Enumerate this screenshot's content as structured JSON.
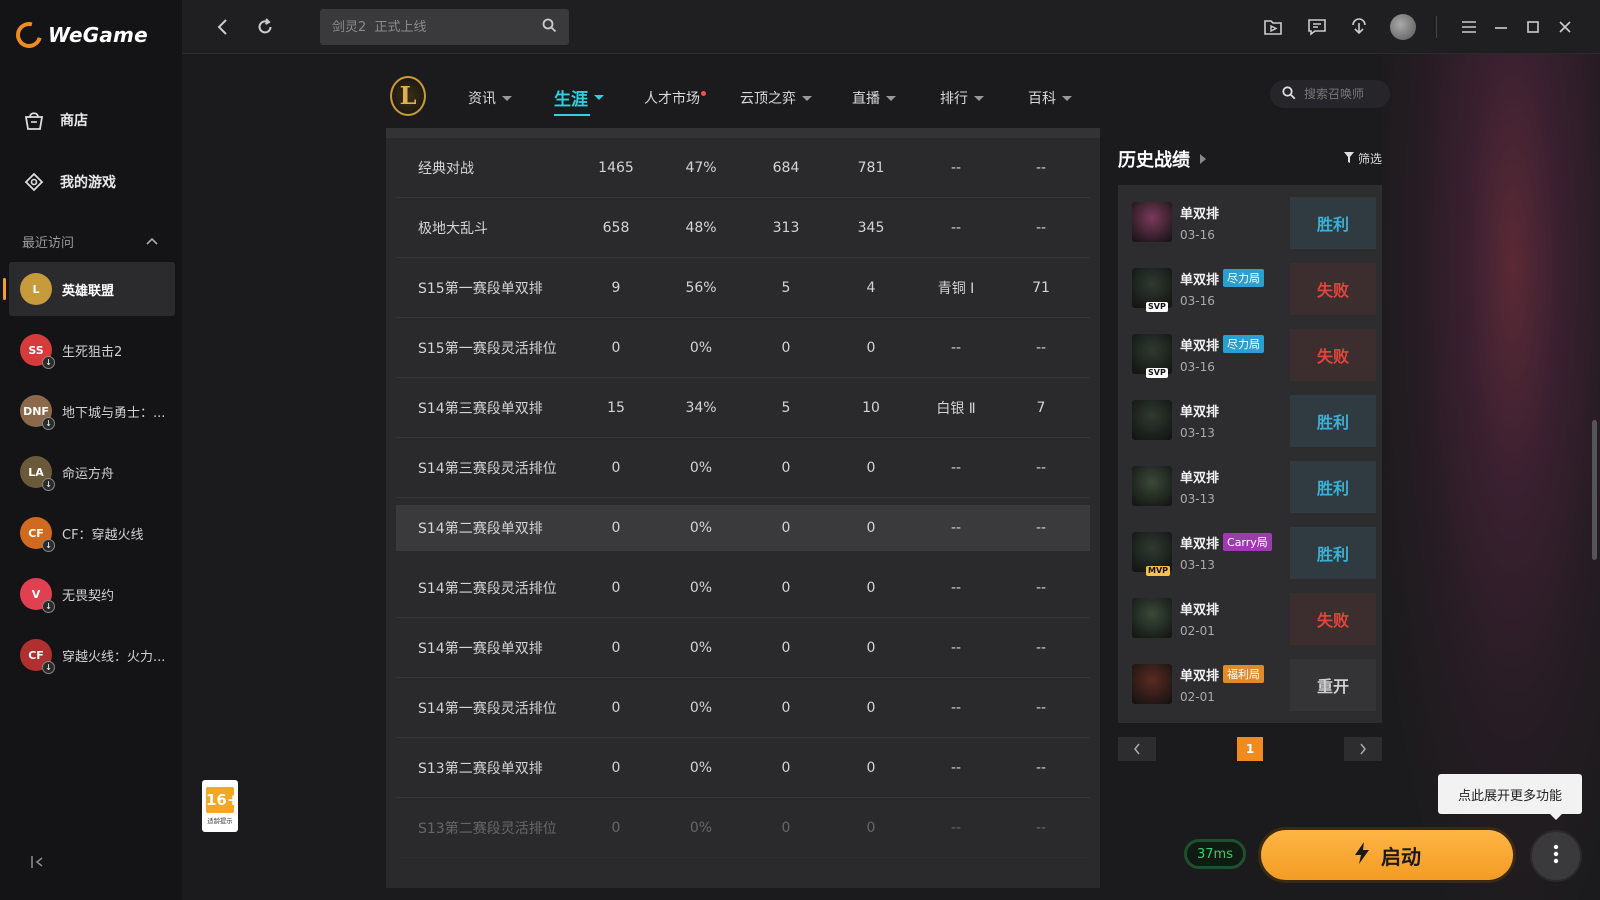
{
  "app": {
    "name": "WeGame"
  },
  "sidebar": {
    "main": [
      {
        "label": "商店",
        "icon": "store-bag-icon"
      },
      {
        "label": "我的游戏",
        "icon": "gamepad-icon"
      }
    ],
    "recent_header": "最近访问",
    "games": [
      {
        "label": "英雄联盟",
        "badge": "L",
        "color": "#c79a3c",
        "active": true
      },
      {
        "label": "生死狙击2",
        "badge": "SS",
        "color": "#d63a3a"
      },
      {
        "label": "地下城与勇士：...",
        "badge": "DNF",
        "color": "#8a6a4a"
      },
      {
        "label": "命运方舟",
        "badge": "LA",
        "color": "#6a5a3a"
      },
      {
        "label": "CF：穿越火线",
        "badge": "CF",
        "color": "#d06a20"
      },
      {
        "label": "无畏契约",
        "badge": "V",
        "color": "#e04050"
      },
      {
        "label": "穿越火线：火力...",
        "badge": "CF",
        "color": "#b03030"
      }
    ],
    "age_rating": {
      "num": "16+",
      "sub": "适龄提示"
    }
  },
  "topbar": {
    "search_placeholder": "剑灵2  正式上线"
  },
  "game_nav": {
    "logo": "L",
    "items": [
      {
        "label": "资讯",
        "caret": true
      },
      {
        "label": "生涯",
        "caret": true,
        "active": true
      },
      {
        "label": "人才市场",
        "caret": false,
        "dot": true
      },
      {
        "label": "云顶之弈",
        "caret": true
      },
      {
        "label": "直播",
        "caret": true
      },
      {
        "label": "排行",
        "caret": true
      },
      {
        "label": "百科",
        "caret": true
      }
    ],
    "summoner_placeholder": "搜索召唤师"
  },
  "stats": {
    "rows": [
      [
        "经典对战",
        "1465",
        "47%",
        "684",
        "781",
        "--",
        "--"
      ],
      [
        "极地大乱斗",
        "658",
        "48%",
        "313",
        "345",
        "--",
        "--"
      ],
      [
        "S15第一赛段单双排",
        "9",
        "56%",
        "5",
        "4",
        "青铜 Ⅰ",
        "71"
      ],
      [
        "S15第一赛段灵活排位",
        "0",
        "0%",
        "0",
        "0",
        "--",
        "--"
      ],
      [
        "S14第三赛段单双排",
        "15",
        "34%",
        "5",
        "10",
        "白银 Ⅱ",
        "7"
      ],
      [
        "S14第三赛段灵活排位",
        "0",
        "0%",
        "0",
        "0",
        "--",
        "--"
      ],
      [
        "S14第二赛段单双排",
        "0",
        "0%",
        "0",
        "0",
        "--",
        "--"
      ],
      [
        "S14第二赛段灵活排位",
        "0",
        "0%",
        "0",
        "0",
        "--",
        "--"
      ],
      [
        "S14第一赛段单双排",
        "0",
        "0%",
        "0",
        "0",
        "--",
        "--"
      ],
      [
        "S14第一赛段灵活排位",
        "0",
        "0%",
        "0",
        "0",
        "--",
        "--"
      ],
      [
        "S13第二赛段单双排",
        "0",
        "0%",
        "0",
        "0",
        "--",
        "--"
      ],
      [
        "S13第二赛段灵活排位",
        "0",
        "0%",
        "0",
        "0",
        "--",
        "--"
      ]
    ]
  },
  "history": {
    "title": "历史战绩",
    "filter_label": "筛选",
    "matches": [
      {
        "mode": "单双排",
        "date": "03-16",
        "result": "胜利",
        "kind": "win",
        "tag": "",
        "tag_color": "",
        "medal": "",
        "champ_color": "#7a3a5a"
      },
      {
        "mode": "单双排",
        "date": "03-16",
        "result": "失败",
        "kind": "loss",
        "tag": "尽力局",
        "tag_color": "#2a9fd0",
        "medal": "SVP",
        "champ_color": "#2f3a30"
      },
      {
        "mode": "单双排",
        "date": "03-16",
        "result": "失败",
        "kind": "loss",
        "tag": "尽力局",
        "tag_color": "#2a9fd0",
        "medal": "SVP",
        "champ_color": "#2f3a30"
      },
      {
        "mode": "单双排",
        "date": "03-13",
        "result": "胜利",
        "kind": "win",
        "tag": "",
        "tag_color": "",
        "medal": "",
        "champ_color": "#2f3a30"
      },
      {
        "mode": "单双排",
        "date": "03-13",
        "result": "胜利",
        "kind": "win",
        "tag": "",
        "tag_color": "",
        "medal": "",
        "champ_color": "#3a4a3a"
      },
      {
        "mode": "单双排",
        "date": "03-13",
        "result": "胜利",
        "kind": "win",
        "tag": "Carry局",
        "tag_color": "#a03ab0",
        "medal": "MVP",
        "champ_color": "#2f3a30"
      },
      {
        "mode": "单双排",
        "date": "02-01",
        "result": "失败",
        "kind": "loss",
        "tag": "",
        "tag_color": "",
        "medal": "",
        "champ_color": "#3a4a3a"
      },
      {
        "mode": "单双排",
        "date": "02-01",
        "result": "重开",
        "kind": "remake",
        "tag": "福利局",
        "tag_color": "#e08a2a",
        "medal": "",
        "champ_color": "#5a2a20"
      }
    ],
    "page": "1"
  },
  "bottom": {
    "ping": "37ms",
    "launch_label": "启动",
    "tooltip": "点此展开更多功能"
  }
}
